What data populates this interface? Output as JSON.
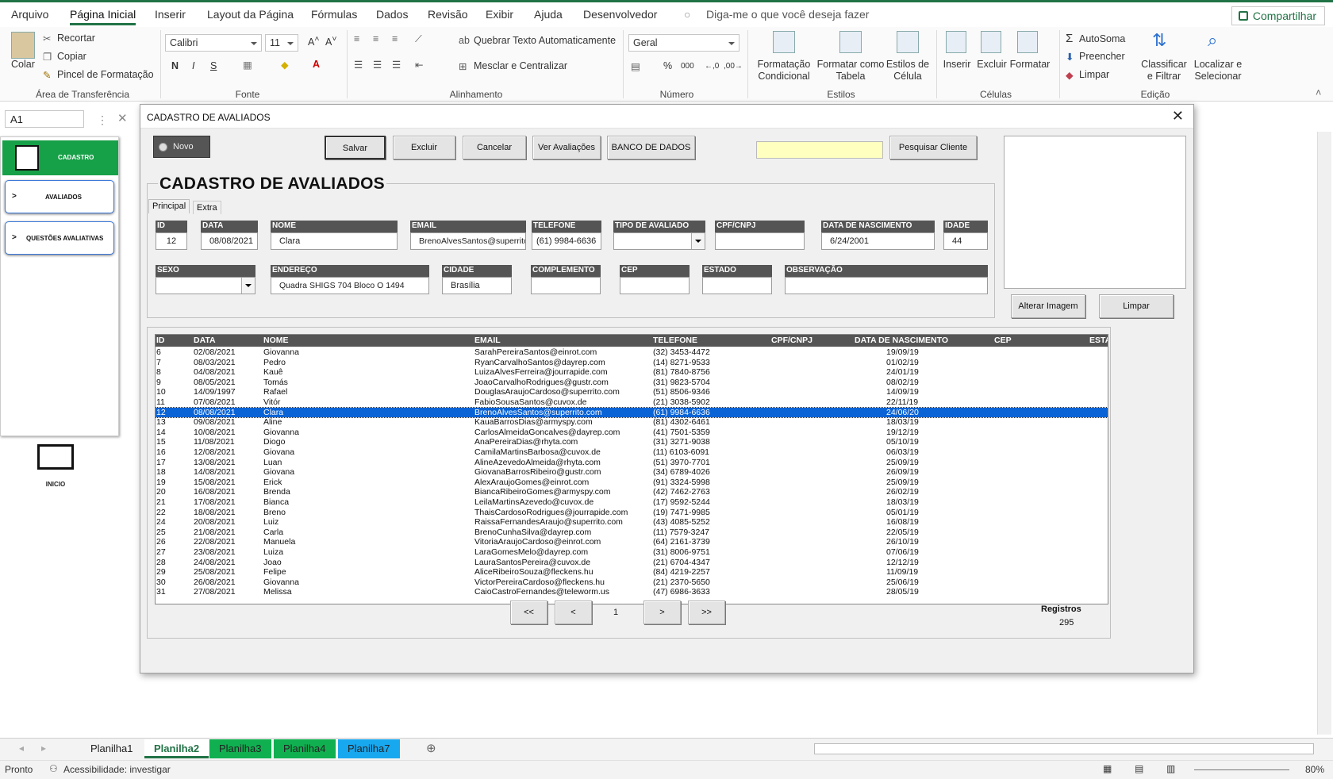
{
  "ribbon_tabs": [
    "Arquivo",
    "Página Inicial",
    "Inserir",
    "Layout da Página",
    "Fórmulas",
    "Dados",
    "Revisão",
    "Exibir",
    "Ajuda",
    "Desenvolvedor"
  ],
  "tellme": "Diga-me o que você deseja fazer",
  "share": "Compartilhar",
  "clipboard": {
    "paste": "Colar",
    "cut": "Recortar",
    "copy": "Copiar",
    "painter": "Pincel de Formatação",
    "label": "Área de Transferência"
  },
  "font": {
    "name": "Calibri",
    "size": "11",
    "bold": "N",
    "italic": "I",
    "underline": "S",
    "label": "Fonte"
  },
  "alignment": {
    "wrap": "Quebrar Texto Automaticamente",
    "merge": "Mesclar e Centralizar",
    "label": "Alinhamento"
  },
  "number": {
    "format": "Geral",
    "percent": "%",
    "thousands": "000",
    "label": "Número"
  },
  "styles": {
    "cond": "Formatação Condicional",
    "table": "Formatar como Tabela",
    "cell": "Estilos de Célula",
    "label": "Estilos"
  },
  "cells": {
    "insert": "Inserir",
    "delete": "Excluir",
    "format": "Formatar",
    "label": "Células"
  },
  "editing": {
    "autosum": "AutoSoma",
    "fill": "Preencher",
    "clear": "Limpar",
    "sort": "Classificar e Filtrar",
    "find": "Localizar e Selecionar",
    "label": "Edição"
  },
  "namebox": "A1",
  "side": {
    "cadastro": "CADASTRO",
    "avaliados": "AVALIADOS",
    "questoes": "QUESTÕES AVALIATIVAS",
    "inicio": "INICIO",
    "arrow": ">"
  },
  "sheets": [
    "Planilha1",
    "Planilha2",
    "Planilha3",
    "Planilha4",
    "Planilha7"
  ],
  "status": {
    "ready": "Pronto",
    "access": "Acessibilidade: investigar",
    "zoom": "80%"
  },
  "dialog": {
    "title": "CADASTRO DE AVALIADOS",
    "close": "✕",
    "novo": "Novo",
    "buttons": {
      "save": "Salvar",
      "delete": "Excluir",
      "cancel": "Cancelar",
      "view": "Ver Avaliações",
      "db": "BANCO DE DADOS",
      "search": "Pesquisar Cliente",
      "alter_img": "Alterar Imagem",
      "clear": "Limpar"
    },
    "heading": "CADASTRO DE AVALIADOS",
    "tab_main": "Principal",
    "tab_extra": "Extra",
    "fields": {
      "id": {
        "label": "ID",
        "value": "12"
      },
      "data": {
        "label": "DATA",
        "value": "08/08/2021"
      },
      "nome": {
        "label": "NOME",
        "value": "Clara"
      },
      "email": {
        "label": "EMAIL",
        "value": "BrenoAlvesSantos@superrito"
      },
      "telefone": {
        "label": "TELEFONE",
        "value": "(61) 9984-6636"
      },
      "tipo": {
        "label": "TIPO DE AVALIADO",
        "value": ""
      },
      "cpf": {
        "label": "CPF/CNPJ",
        "value": ""
      },
      "nasc": {
        "label": "DATA DE NASCIMENTO",
        "value": "6/24/2001"
      },
      "idade": {
        "label": "IDADE",
        "value": "44"
      },
      "sexo": {
        "label": "SEXO",
        "value": ""
      },
      "endereco": {
        "label": "ENDEREÇO",
        "value": "Quadra SHIGS 704 Bloco O 1494"
      },
      "cidade": {
        "label": "CIDADE",
        "value": "Brasília"
      },
      "complemento": {
        "label": "COMPLEMENTO",
        "value": ""
      },
      "cep": {
        "label": "CEP",
        "value": ""
      },
      "estado": {
        "label": "ESTADO",
        "value": ""
      },
      "obs": {
        "label": "OBSERVAÇÃO",
        "value": ""
      }
    },
    "list_headers": [
      "ID",
      "DATA",
      "NOME",
      "EMAIL",
      "TELEFONE",
      "CPF/CNPJ",
      "DATA DE NASCIMENTO",
      "CEP",
      "ESTADO"
    ],
    "selected_id": "12",
    "rows": [
      [
        "6",
        "02/08/2021",
        "Giovanna",
        "SarahPereiraSantos@einrot.com",
        "(32) 3453-4472",
        "19/09/19"
      ],
      [
        "7",
        "08/03/2021",
        "Pedro",
        "RyanCarvalhoSantos@dayrep.com",
        "(14) 8271-9533",
        "01/02/19"
      ],
      [
        "8",
        "04/08/2021",
        "Kauê",
        "LuizaAlvesFerreira@jourrapide.com",
        "(81) 7840-8756",
        "24/01/19"
      ],
      [
        "9",
        "08/05/2021",
        "Tomás",
        "JoaoCarvalhoRodrigues@gustr.com",
        "(31) 9823-5704",
        "08/02/19"
      ],
      [
        "10",
        "14/09/1997",
        "Rafael",
        "DouglasAraujoCardoso@superrito.com",
        "(51) 8506-9346",
        "14/09/19"
      ],
      [
        "11",
        "07/08/2021",
        "Vitór",
        "FabioSousaSantos@cuvox.de",
        "(21) 3038-5902",
        "22/11/19"
      ],
      [
        "12",
        "08/08/2021",
        "Clara",
        "BrenoAlvesSantos@superrito.com",
        "(61) 9984-6636",
        "24/06/20"
      ],
      [
        "13",
        "09/08/2021",
        "Aline",
        "KauaBarrosDias@armyspy.com",
        "(81) 4302-6461",
        "18/03/19"
      ],
      [
        "14",
        "10/08/2021",
        "Giovanna",
        "CarlosAlmeidaGoncalves@dayrep.com",
        "(41) 7501-5359",
        "19/12/19"
      ],
      [
        "15",
        "11/08/2021",
        "Diogo",
        "AnaPereiraDias@rhyta.com",
        "(31) 3271-9038",
        "05/10/19"
      ],
      [
        "16",
        "12/08/2021",
        "Giovana",
        "CamilaMartinsBarbosa@cuvox.de",
        "(11) 6103-6091",
        "06/03/19"
      ],
      [
        "17",
        "13/08/2021",
        "Luan",
        "AlineAzevedoAlmeida@rhyta.com",
        "(51) 3970-7701",
        "25/09/19"
      ],
      [
        "18",
        "14/08/2021",
        "Giovana",
        "GiovanaBarrosRibeiro@gustr.com",
        "(34) 6789-4026",
        "26/09/19"
      ],
      [
        "19",
        "15/08/2021",
        "Erick",
        "AlexAraujoGomes@einrot.com",
        "(91) 3324-5998",
        "25/09/19"
      ],
      [
        "20",
        "16/08/2021",
        "Brenda",
        "BiancaRibeiroGomes@armyspy.com",
        "(42) 7462-2763",
        "26/02/19"
      ],
      [
        "21",
        "17/08/2021",
        "Bianca",
        "LeilaMartinsAzevedo@cuvox.de",
        "(17) 9592-5244",
        "18/03/19"
      ],
      [
        "22",
        "18/08/2021",
        "Breno",
        "ThaisCardosoRodrigues@jourrapide.com",
        "(19) 7471-9985",
        "05/01/19"
      ],
      [
        "24",
        "20/08/2021",
        "Luiz",
        "RaissaFernandesAraujo@superrito.com",
        "(43) 4085-5252",
        "16/08/19"
      ],
      [
        "25",
        "21/08/2021",
        "Carla",
        "BrenoCunhaSilva@dayrep.com",
        "(11) 7579-3247",
        "22/05/19"
      ],
      [
        "26",
        "22/08/2021",
        "Manuela",
        "VitoriaAraujoCardoso@einrot.com",
        "(64) 2161-3739",
        "26/10/19"
      ],
      [
        "27",
        "23/08/2021",
        "Luiza",
        "LaraGomesMelo@dayrep.com",
        "(31) 8006-9751",
        "07/06/19"
      ],
      [
        "28",
        "24/08/2021",
        "Joao",
        "LauraSantosPereira@cuvox.de",
        "(21) 6704-4347",
        "12/12/19"
      ],
      [
        "29",
        "25/08/2021",
        "Felipe",
        "AliceRibeiroSouza@fleckens.hu",
        "(84) 4219-2257",
        "11/09/19"
      ],
      [
        "30",
        "26/08/2021",
        "Giovanna",
        "VictorPereiraCardoso@fleckens.hu",
        "(21) 2370-5650",
        "25/06/19"
      ],
      [
        "31",
        "27/08/2021",
        "Melissa",
        "CaioCastroFernandes@teleworm.us",
        "(47) 6986-3633",
        "28/05/19"
      ]
    ],
    "pager": {
      "first": "<<",
      "prev": "<",
      "page": "1",
      "next": ">",
      "last": ">>"
    },
    "registros_label": "Registros",
    "registros_value": "295"
  }
}
